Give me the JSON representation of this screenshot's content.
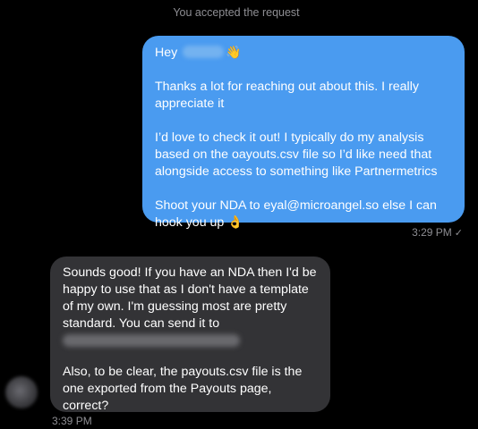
{
  "system_notice": "You accepted the request",
  "outgoing_message": {
    "greeting": "Hey",
    "paragraph_1": "Thanks a lot for reaching out about this. I really appreciate it",
    "paragraph_2": "I’d love to check it out! I typically do my analysis based on the oayouts.csv file so I’d like need that alongside access to something like Partnermetrics",
    "paragraph_3": "Shoot your NDA to eyal@microangel.so else I can hook you up",
    "wave_emoji": "👋",
    "ok_emoji": "👌",
    "timestamp": "3:29 PM",
    "read_mark": "✓"
  },
  "incoming_message": {
    "paragraph_1": "Sounds good! If you have an NDA then I'd be happy to use that as I don't have a template of my own. I'm guessing most are pretty standard. You can send it to",
    "paragraph_2": "Also, to be clear, the payouts.csv file is the one exported from the Payouts page, correct?",
    "timestamp": "3:39 PM"
  },
  "colors": {
    "outgoing_bubble": "#4a9bf0",
    "incoming_bubble": "#333336",
    "background": "#000000",
    "meta_text": "#8e8e93"
  }
}
